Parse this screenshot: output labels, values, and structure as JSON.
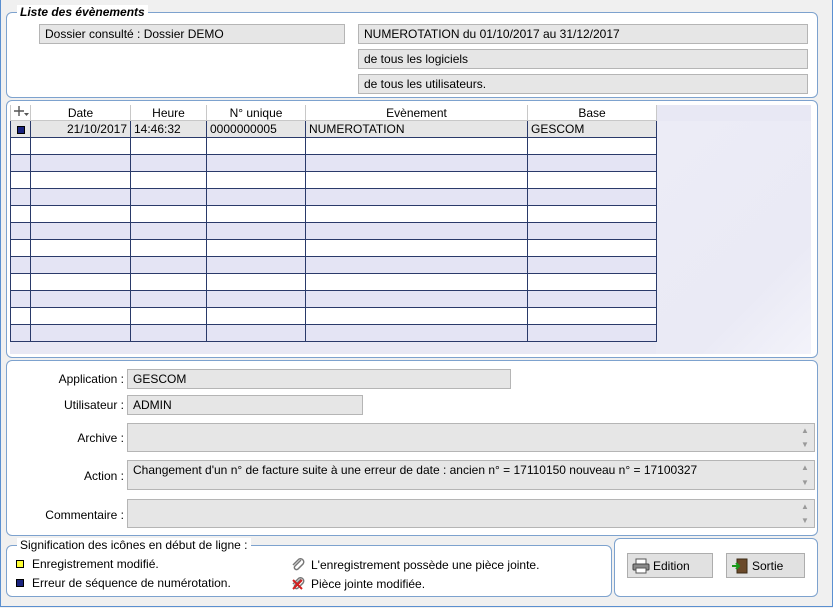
{
  "header": {
    "group_title": "Liste des évènements",
    "dossier": "Dossier consulté : Dossier DEMO",
    "numerotation": "NUMEROTATION du 01/10/2017 au 31/12/2017",
    "logiciels": "de tous les logiciels",
    "utilisateurs": "de tous les utilisateurs."
  },
  "table": {
    "columns": [
      "Date",
      "Heure",
      "N° unique",
      "Evènement",
      "Base"
    ],
    "rows": [
      {
        "date": "21/10/2017",
        "heure": "14:46:32",
        "numero": "0000000005",
        "evenement": "NUMEROTATION",
        "base": "GESCOM"
      }
    ]
  },
  "details": {
    "application_label": "Application :",
    "application_value": "GESCOM",
    "utilisateur_label": "Utilisateur :",
    "utilisateur_value": "ADMIN",
    "archive_label": "Archive :",
    "archive_value": "",
    "action_label": "Action :",
    "action_value": "Changement d'un n° de facture suite à une erreur de date : ancien n° = 17110150 nouveau n° = 17100327",
    "commentaire_label": "Commentaire :",
    "commentaire_value": ""
  },
  "legend": {
    "title": "Signification des icônes en début de ligne :",
    "modified": "Enregistrement modifié.",
    "sequence_error": "Erreur de séquence de numérotation.",
    "attachment": "L'enregistrement possède une pièce jointe.",
    "attachment_modified": "Pièce jointe modifiée."
  },
  "buttons": {
    "edition": "Edition",
    "sortie": "Sortie"
  },
  "colors": {
    "border": "#7da2ce",
    "marker_blue": "#1a237e",
    "marker_yellow": "#ffff33",
    "row_alt": "#e4e4f4"
  }
}
